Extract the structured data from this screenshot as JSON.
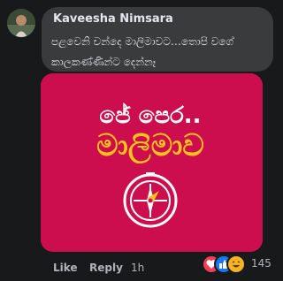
{
  "comment": {
    "author": "Kaveesha Nimsara",
    "text": "පළවෙනි චන්දෙ මාලිමාවට…තොපි වගේ කාලකණ්ණින්ට දෙන්නෑ"
  },
  "attachment": {
    "logo_text_line1": "ජේ පෙර..",
    "logo_text_line2": "මාලිමාව",
    "colors": {
      "background": "#cc0e4e",
      "text_white": "#ffffff",
      "text_yellow": "#ffc21a",
      "compass": "#ffffff"
    }
  },
  "actions": {
    "like_label": "Like",
    "reply_label": "Reply",
    "time": "1h"
  },
  "reactions": {
    "icons": [
      "love-icon",
      "like-icon",
      "haha-icon"
    ],
    "count": "145"
  },
  "colors": {
    "background": "#18191a",
    "bubble": "#3a3b3c",
    "text_primary": "#e4e6eb",
    "text_secondary": "#b0b3b8"
  }
}
